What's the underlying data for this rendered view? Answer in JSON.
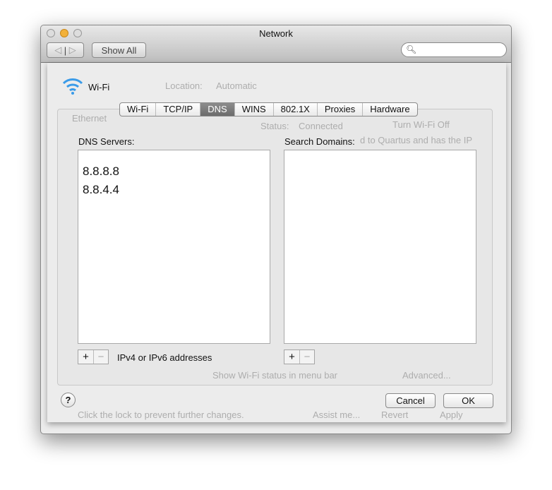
{
  "window": {
    "title": "Network",
    "show_all": "Show All",
    "search_placeholder": ""
  },
  "background": {
    "location_label": "Location:",
    "location_value": "Automatic",
    "service_name": "Ethernet",
    "service_status": "Connected",
    "status_label": "Status:",
    "status_value": "Connected",
    "turn_off": "Turn Wi-Fi Off",
    "info_text": "d to Quartus and has the IP",
    "show_status": "Show Wi-Fi status in menu bar",
    "advanced": "Advanced...",
    "lock_text": "Click the lock to prevent further changes.",
    "assist": "Assist me...",
    "revert": "Revert",
    "apply": "Apply"
  },
  "sheet": {
    "service": "Wi-Fi",
    "tabs": [
      "Wi-Fi",
      "TCP/IP",
      "DNS",
      "WINS",
      "802.1X",
      "Proxies",
      "Hardware"
    ],
    "selected_tab": "DNS",
    "dns_label": "DNS Servers:",
    "dns_servers": [
      "8.8.8.8",
      "8.8.4.4"
    ],
    "search_label": "Search Domains:",
    "search_domains": [],
    "add": "+",
    "remove": "−",
    "hint": "IPv4 or IPv6 addresses",
    "help": "?",
    "cancel": "Cancel",
    "ok": "OK"
  }
}
